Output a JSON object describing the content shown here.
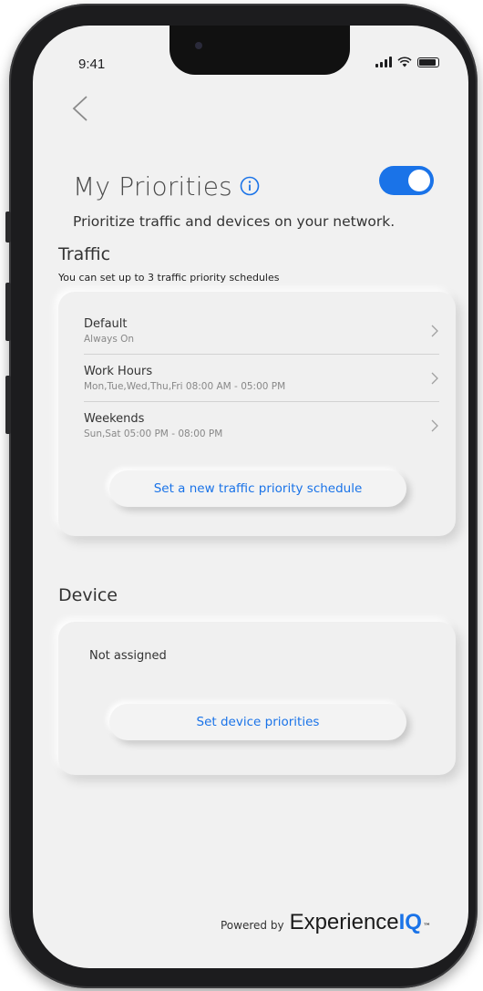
{
  "status_bar": {
    "time": "9:41"
  },
  "header": {
    "title": "My Priorities",
    "subtitle": "Prioritize traffic and devices on your network.",
    "toggle_on": true
  },
  "traffic": {
    "heading": "Traffic",
    "note": "You can set up to 3 traffic priority schedules",
    "schedules": [
      {
        "name": "Default",
        "detail": "Always On"
      },
      {
        "name": "Work Hours",
        "detail": "Mon,Tue,Wed,Thu,Fri  08:00 AM - 05:00 PM"
      },
      {
        "name": "Weekends",
        "detail": "Sun,Sat  05:00 PM - 08:00 PM"
      }
    ],
    "new_schedule_label": "Set a new traffic priority schedule"
  },
  "device": {
    "heading": "Device",
    "status": "Not assigned",
    "set_priorities_label": "Set device priorities"
  },
  "footer": {
    "powered_by": "Powered by",
    "brand": "Experience",
    "brand_accent": "IQ",
    "trademark": "™"
  },
  "colors": {
    "accent": "#1a73e8",
    "background": "#f1f1f1",
    "device_frame": "#1c1c1e"
  },
  "icons": [
    "back-chevron-icon",
    "info-icon",
    "chevron-right-icon",
    "signal-icon",
    "wifi-icon",
    "battery-icon"
  ]
}
